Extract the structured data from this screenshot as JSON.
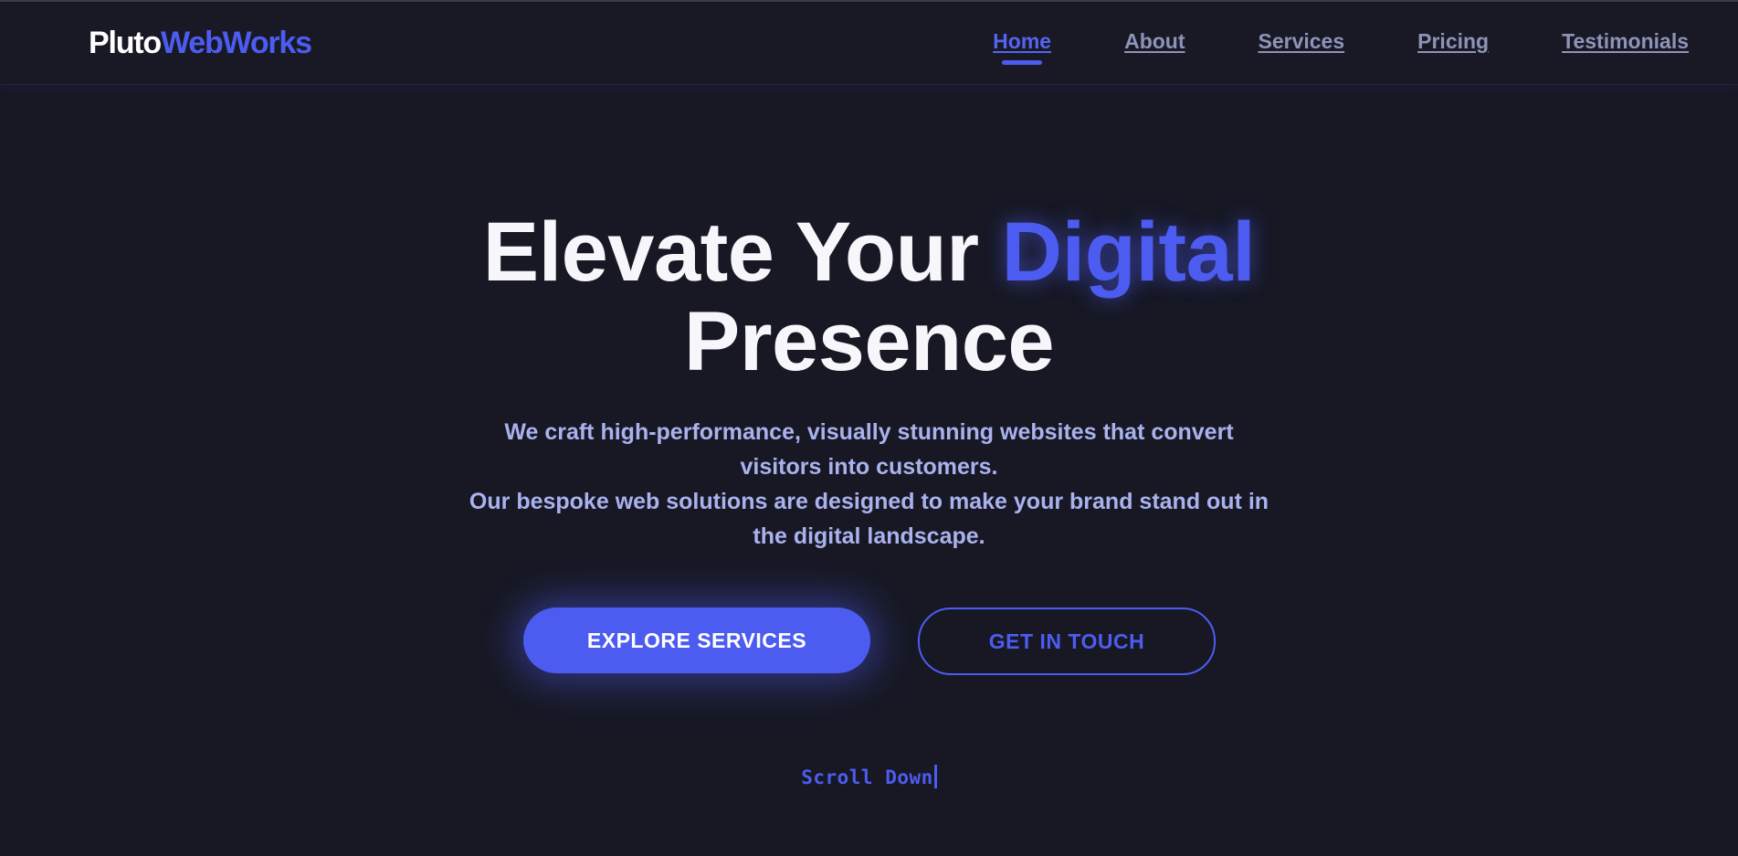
{
  "header": {
    "logo": {
      "part1": "Pluto",
      "part2": "WebWorks"
    },
    "nav": [
      {
        "label": "Home",
        "active": true
      },
      {
        "label": "About",
        "active": false
      },
      {
        "label": "Services",
        "active": false
      },
      {
        "label": "Pricing",
        "active": false
      },
      {
        "label": "Testimonials",
        "active": false
      }
    ]
  },
  "hero": {
    "title_part1": "Elevate Your",
    "title_accent": "Digital",
    "title_part2": "Presence",
    "subtitle_line1": "We craft high-performance, visually stunning websites that convert visitors into customers.",
    "subtitle_line2": "Our bespoke web solutions are designed to make your brand stand out in the digital landscape.",
    "primary_button": "EXPLORE SERVICES",
    "secondary_button": "GET IN TOUCH",
    "scroll_hint": "Scroll Down"
  },
  "colors": {
    "background": "#171824",
    "accent": "#4d5cf0",
    "nav_text": "#8f93b8",
    "subtitle_text": "#aab2ee",
    "title_text": "#f6f6fb"
  }
}
